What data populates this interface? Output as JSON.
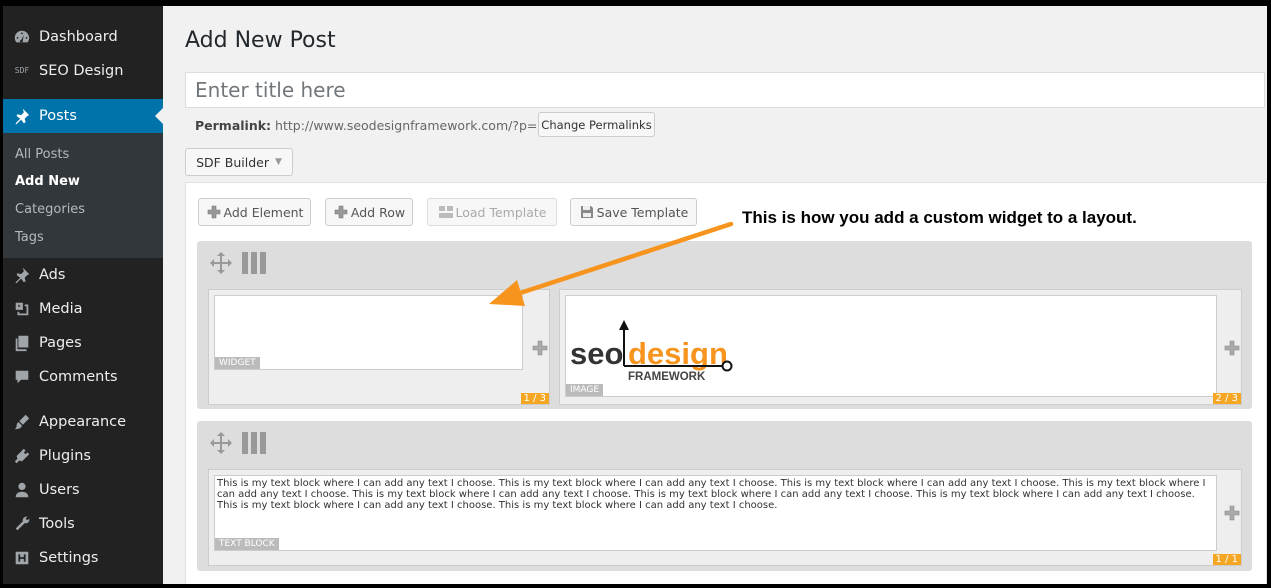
{
  "sidebar": {
    "items": [
      {
        "label": "Dashboard",
        "icon": "dashboard-icon"
      },
      {
        "label": "SEO Design",
        "icon": "sdf-icon",
        "icon_text": "SDF"
      },
      {
        "label": "Posts",
        "icon": "pin-icon",
        "active": true
      },
      {
        "label": "Ads",
        "icon": "pin-icon"
      },
      {
        "label": "Media",
        "icon": "media-icon"
      },
      {
        "label": "Pages",
        "icon": "pages-icon"
      },
      {
        "label": "Comments",
        "icon": "comment-icon"
      },
      {
        "label": "Appearance",
        "icon": "brush-icon"
      },
      {
        "label": "Plugins",
        "icon": "plug-icon"
      },
      {
        "label": "Users",
        "icon": "user-icon"
      },
      {
        "label": "Tools",
        "icon": "wrench-icon"
      },
      {
        "label": "Settings",
        "icon": "settings-icon"
      }
    ],
    "submenu": [
      "All Posts",
      "Add New",
      "Categories",
      "Tags"
    ],
    "submenu_current": "Add New"
  },
  "page": {
    "title": "Add New Post",
    "title_placeholder": "Enter title here",
    "permalink_label": "Permalink:",
    "permalink_url": "http://www.seodesignframework.com/?p=36",
    "change_permalink_button": "Change Permalinks",
    "builder_select": "SDF Builder"
  },
  "toolbar": {
    "add_element": "Add Element",
    "add_row": "Add Row",
    "load_template": "Load Template",
    "save_template": "Save Template"
  },
  "annotation": "This is how you add a custom widget to a layout.",
  "rows": [
    {
      "columns": [
        {
          "element_label": "WIDGET",
          "size": "1 / 3"
        },
        {
          "element_label": "IMAGE",
          "size": "2 / 3",
          "logo": {
            "seo": "seo",
            "design": "design",
            "framework": "FRAMEWORK"
          }
        }
      ]
    },
    {
      "columns": [
        {
          "element_label": "TEXT BLOCK",
          "size": "1 / 1",
          "text": "This is my text block where I can add any text I choose. This is my text block where I can add any text I choose. This is my text block where I can add any text I choose. This is my text block where I can add any text I choose. This is my text block where I can add any text I choose. This is my text block where I can add any text I choose. This is my text block where I can add any text I choose. This is my text block where I can add any text I choose. This is my text block where I can add any text I choose."
        }
      ]
    }
  ],
  "colors": {
    "sidebar_bg": "#222222",
    "active_blue": "#0073aa",
    "column_size_badge": "#f5a623",
    "arrow": "#f7941d",
    "logo_orange": "#f7941d"
  }
}
